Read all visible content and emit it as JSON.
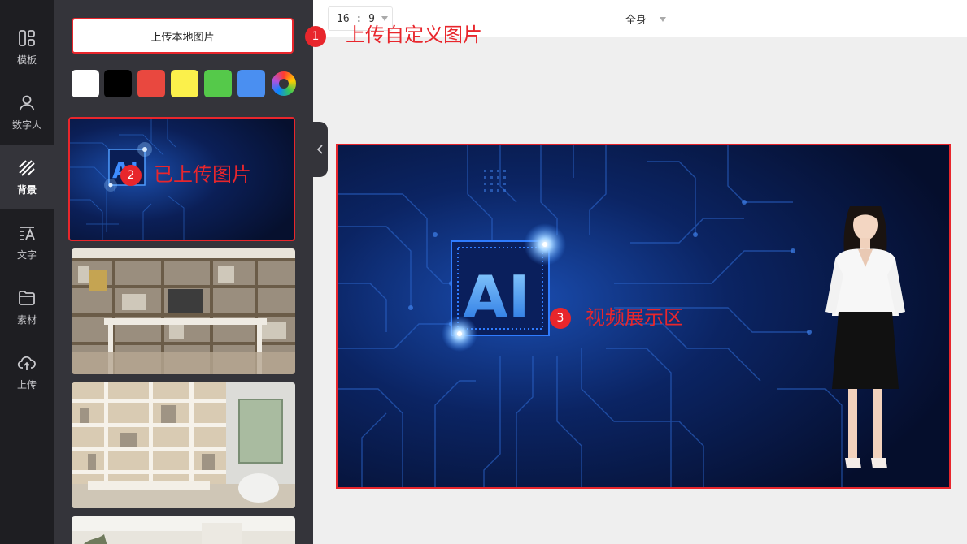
{
  "sidebar": {
    "items": [
      {
        "label": "模板",
        "icon": "template-icon"
      },
      {
        "label": "数字人",
        "icon": "person-icon"
      },
      {
        "label": "背景",
        "icon": "background-icon",
        "active": true
      },
      {
        "label": "文字",
        "icon": "text-icon"
      },
      {
        "label": "素材",
        "icon": "folder-icon"
      },
      {
        "label": "上传",
        "icon": "upload-cloud-icon"
      }
    ]
  },
  "panel": {
    "upload_label": "上传本地图片",
    "swatches": [
      "#ffffff",
      "#000000",
      "#e9483f",
      "#fbf04b",
      "#55c94a",
      "#4a8ff1"
    ],
    "color_picker_icon": "color-wheel-icon"
  },
  "toolbar": {
    "aspect_ratio": "16 : 9",
    "body_mode": "全身"
  },
  "annotations": [
    {
      "number": "1",
      "text": "上传自定义图片"
    },
    {
      "number": "2",
      "text": "已上传图片"
    },
    {
      "number": "3",
      "text": "视频展示区"
    }
  ],
  "video": {
    "chip_text": "AI"
  },
  "colors": {
    "annotation_red": "#e8262c",
    "rail_bg": "#1e1e22",
    "panel_bg": "#34343a",
    "canvas_bg": "#efefef"
  }
}
